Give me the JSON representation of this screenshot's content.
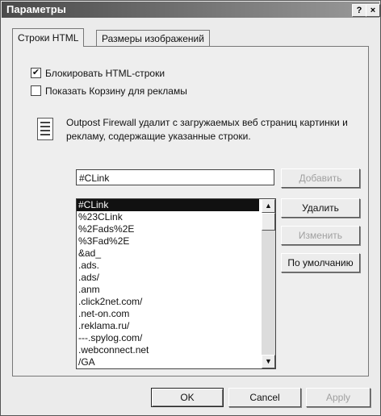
{
  "window": {
    "title": "Параметры",
    "help_label": "?",
    "close_label": "×"
  },
  "tabs": [
    {
      "label": "Строки HTML"
    },
    {
      "label": "Размеры изображений"
    }
  ],
  "options": {
    "block_html": {
      "label": "Блокировать HTML-строки",
      "checked": true,
      "mark": "✔"
    },
    "show_trash": {
      "label": "Показать Корзину для рекламы",
      "checked": false
    }
  },
  "info": {
    "text": "Outpost Firewall удалит с загружаемых веб страниц картинки и рекламу, содержащие указанные строки."
  },
  "input": {
    "value": "#CLink"
  },
  "list": {
    "items": [
      "#CLink",
      "%23CLink",
      "%2Fads%2E",
      "%3Fad%2E",
      "&ad_",
      ".ads.",
      ".ads/",
      ".anm",
      ".click2net.com/",
      ".net-on.com",
      ".reklama.ru/",
      "---.spylog.com/",
      ".webconnect.net",
      "/GA"
    ],
    "selected_index": 0,
    "scroll_up": "▲",
    "scroll_down": "▼"
  },
  "actions": {
    "add_label": "Добавить",
    "delete_label": "Удалить",
    "change_label": "Изменить",
    "default_label": "По умолчанию"
  },
  "footer": {
    "ok_label": "OK",
    "cancel_label": "Cancel",
    "apply_label": "Apply"
  }
}
